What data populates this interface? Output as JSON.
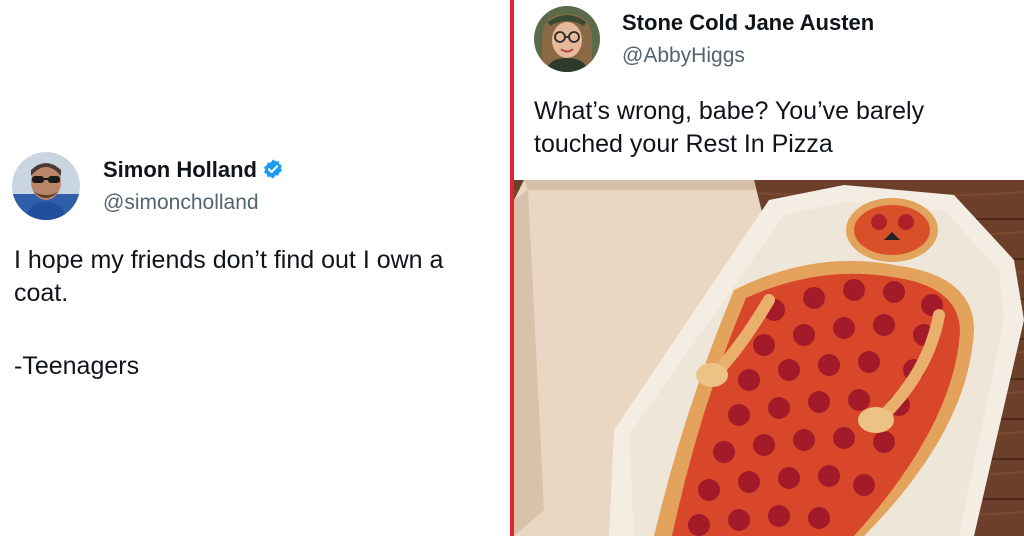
{
  "left_tweet": {
    "display_name": "Simon Holland",
    "handle": "@simoncholland",
    "avatar_icon": "profile-photo-man-sunglasses",
    "verified_icon": "verified-badge-icon",
    "verified_color": "#1d9bf0",
    "text_line1": "I hope my friends don’t find out I own a coat.",
    "text_line2": "-Teenagers"
  },
  "right_tweet": {
    "display_name": "Stone Cold Jane Austen",
    "handle": "@AbbyHiggs",
    "avatar_icon": "profile-photo-woman-glasses",
    "text": "What’s wrong, babe? You’ve barely touched your Rest In Pizza",
    "image_description_icon": "human-shaped-pizza-in-coffin-box"
  },
  "colors": {
    "divider": "#e0242d",
    "handle_gray": "#536471",
    "text_black": "#0f1419"
  }
}
